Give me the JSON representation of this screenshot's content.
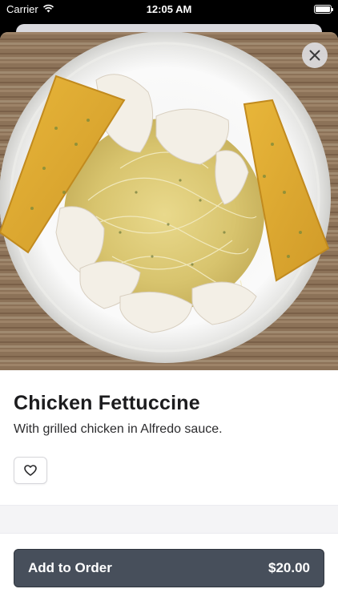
{
  "status_bar": {
    "carrier": "Carrier",
    "time": "12:05 AM",
    "wifi_icon": "wifi-icon",
    "battery_icon": "battery-icon"
  },
  "item": {
    "image_alt": "fettuccine-dish-photo",
    "name": "Chicken Fettuccine",
    "description": "With grilled chicken in Alfredo sauce."
  },
  "actions": {
    "close_icon": "close-icon",
    "favorite_icon": "heart-icon",
    "add_label": "Add to Order",
    "price": "$20.00"
  },
  "colors": {
    "button_bg": "#474f5b",
    "title": "#1c1c1e"
  }
}
